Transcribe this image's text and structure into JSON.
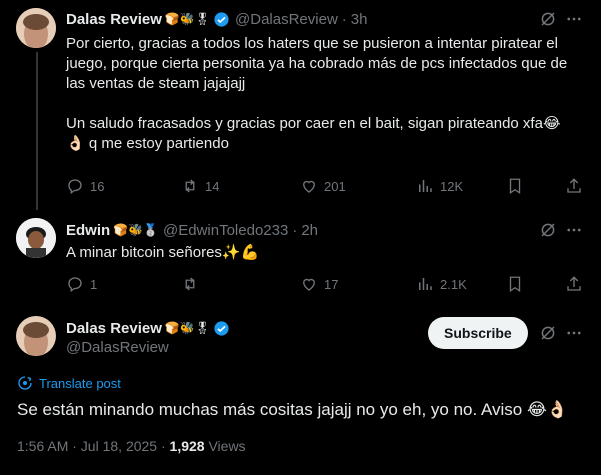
{
  "colors": {
    "accent": "#1d9bf0",
    "muted": "#71767b",
    "text": "#e7e9ea",
    "background": "#000000"
  },
  "post1": {
    "name": "Dalas Review",
    "name_badges": "🍞🐝🎖",
    "handle": "@DalasReview",
    "time": "3h",
    "text_p1": "Por cierto, gracias a todos los haters que se pusieron a intentar piratear el juego, porque cierta personita ya ha cobrado más de pcs infectados que de las ventas de steam jajajajj",
    "text_p2a": "Un saludo fracasados y gracias por caer en el bait, sigan pirateando xfa😂",
    "text_p2b": "👌🏻 q me estoy partiendo",
    "replies": "16",
    "reposts": "14",
    "likes": "201",
    "views": "12K"
  },
  "post2": {
    "name": "Edwin",
    "name_badges": "🍞🐝🥈",
    "handle": "@EdwinToledo233",
    "time": "2h",
    "text": "A minar bitcoin señores✨💪",
    "replies": "1",
    "reposts": "",
    "likes": "17",
    "views": "2.1K"
  },
  "post3": {
    "name": "Dalas Review",
    "name_badges": "🍞🐝🎖",
    "handle": "@DalasReview",
    "subscribe_label": "Subscribe",
    "translate_label": "Translate post",
    "text": "Se están minando muchas más cositas jajajj no yo eh, yo no. Aviso 😂👌🏻",
    "timestamp": "1:56 AM · Jul 18, 2025 · ",
    "views_count": "1,928",
    "views_label": " Views"
  }
}
